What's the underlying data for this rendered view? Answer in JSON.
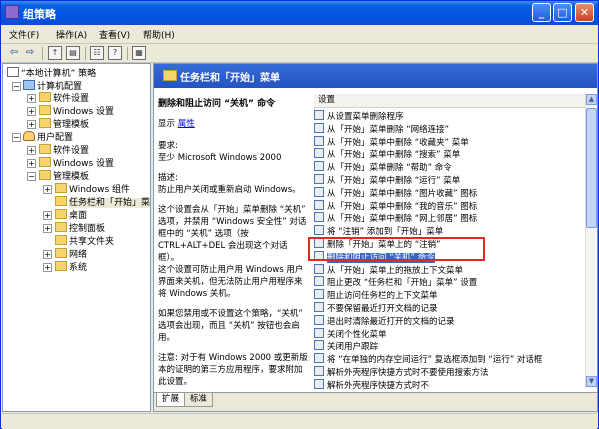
{
  "window": {
    "title": "组策略"
  },
  "menu": [
    {
      "label": "文件(F)"
    },
    {
      "label": "操作(A)"
    },
    {
      "label": "查看(V)"
    },
    {
      "label": "帮助(H)"
    }
  ],
  "toolbar": {
    "back": "back-arrow-icon",
    "forward": "forward-arrow-icon",
    "up": "up-folder-icon",
    "show_hide": "show-hide-tree-icon",
    "properties": "properties-icon",
    "help": "help-icon",
    "view": "view-icon"
  },
  "tree": {
    "root": "“本地计算机” 策略",
    "items": [
      {
        "label": "计算机配置"
      },
      {
        "label": "软件设置"
      },
      {
        "label": "Windows 设置"
      },
      {
        "label": "管理模板"
      },
      {
        "label": "用户配置"
      },
      {
        "label": "软件设置"
      },
      {
        "label": "Windows 设置"
      },
      {
        "label": "管理模板"
      },
      {
        "label": "Windows 组件"
      },
      {
        "label": "任务栏和「开始」菜"
      },
      {
        "label": "桌面"
      },
      {
        "label": "控制面板"
      },
      {
        "label": "共享文件夹"
      },
      {
        "label": "网络"
      },
      {
        "label": "系统"
      }
    ]
  },
  "right_header": {
    "title": "任务栏和「开始」菜单"
  },
  "extended": {
    "policy_title": "删除和阻止访问 “关机” 命令",
    "display_label": "显示",
    "properties_link": "属性",
    "requirements_label": "要求:",
    "requirements_text": "至少 Microsoft Windows 2000",
    "description_label": "描述:",
    "description_text": "防止用户关闭或重新启动 Windows。",
    "para1": "这个设置会从「开始」菜单删除 “关机” 选项，并禁用 “Windows 安全性” 对话框中的 “关机” 选项（按 CTRL+ALT+DEL 会出现这个对话框）。",
    "para2": "这个设置可防止用户用 Windows 用户界面来关机，但无法防止用户用程序来将 Windows 关机。",
    "para3": "如果您禁用或不设置这个策略，“关机” 选项会出现，而且 “关机” 按钮也会启用。",
    "para4": "注意: 对于有 Windows 2000 或更新版本的证明的第三方应用程序，要求附加此设置。"
  },
  "settings": {
    "header": "设置",
    "rows": [
      {
        "label": "从设置菜单删除程序"
      },
      {
        "label": "从「开始」菜单删除 “网络连接”"
      },
      {
        "label": "从「开始」菜单中删除 “收藏夹” 菜单"
      },
      {
        "label": "从「开始」菜单中删除 “搜索” 菜单"
      },
      {
        "label": "从「开始」菜单删除 “帮助” 命令"
      },
      {
        "label": "从「开始」菜单中删除 “运行” 菜单"
      },
      {
        "label": "从「开始」菜单中删除 “图片收藏” 图标"
      },
      {
        "label": "从「开始」菜单中删除 “我的音乐” 图标"
      },
      {
        "label": "从「开始」菜单中删除 “网上邻居” 图标"
      },
      {
        "label": "将 “注销” 添加到「开始」菜单"
      },
      {
        "label": "删除「开始」菜单上的 “注销”"
      },
      {
        "label": "删除和阻止访问 “关机” 命令",
        "selected": true
      },
      {
        "label": "从「开始」菜单上的拖放上下文菜单"
      },
      {
        "label": "阻止更改 “任务栏和「开始」菜单” 设置"
      },
      {
        "label": "阻止访问任务栏的上下文菜单"
      },
      {
        "label": "不要保留最近打开文档的记录"
      },
      {
        "label": "退出时清除最近打开的文档的记录"
      },
      {
        "label": "关闭个性化菜单"
      },
      {
        "label": "关闭用户跟踪"
      },
      {
        "label": "将 “在单独的内存空间运行” 复选框添加到 “运行” 对话框"
      },
      {
        "label": "解析外壳程序快捷方式时不要使用搜索方法"
      },
      {
        "label": "解析外壳程序快捷方式时不"
      }
    ]
  },
  "tabs": [
    {
      "label": "扩展"
    },
    {
      "label": "标准"
    }
  ]
}
